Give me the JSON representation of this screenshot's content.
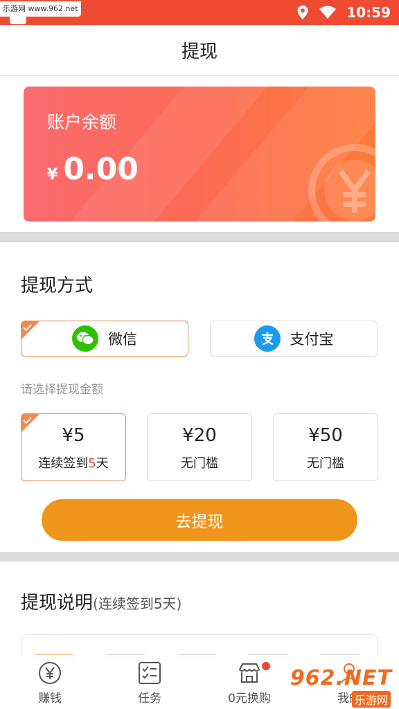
{
  "status_bar": {
    "watermark_text": "乐游网 www.962.net",
    "time": "10:59",
    "icons": [
      "location-icon",
      "wifi-icon"
    ]
  },
  "header": {
    "title": "提现"
  },
  "balance": {
    "label": "账户余额",
    "currency_symbol": "¥",
    "amount": "0.00"
  },
  "withdraw_method": {
    "title": "提现方式",
    "options": [
      {
        "label": "微信",
        "icon": "wechat-icon",
        "color": "#2dc100",
        "selected": true
      },
      {
        "label": "支付宝",
        "icon": "alipay-icon",
        "color": "#1a9bf0",
        "selected": false
      }
    ]
  },
  "amount_select": {
    "hint": "请选择提现金额",
    "options": [
      {
        "value": "¥5",
        "cond_prefix": "连续签到",
        "cond_highlight": "5",
        "cond_suffix": "天",
        "selected": true
      },
      {
        "value": "¥20",
        "cond": "无门槛",
        "selected": false
      },
      {
        "value": "¥50",
        "cond": "无门槛",
        "selected": false
      }
    ]
  },
  "withdraw_button": {
    "label": "去提现"
  },
  "instructions": {
    "title": "提现说明",
    "subtitle": "(连续签到5天)"
  },
  "bottom_nav": {
    "items": [
      {
        "label": "赚钱",
        "icon": "yen-coin-icon"
      },
      {
        "label": "任务",
        "icon": "checklist-icon"
      },
      {
        "label": "0元换购",
        "icon": "shop-icon",
        "badge": true
      },
      {
        "label": "我的",
        "icon": "profile-icon"
      }
    ]
  },
  "watermark": {
    "big": "962.NET",
    "small": "乐游网"
  },
  "colors": {
    "status_bar": "#f04a33",
    "accent_orange": "#ef951b",
    "selected_border": "#f08a52",
    "highlight_red": "#f0452e"
  }
}
